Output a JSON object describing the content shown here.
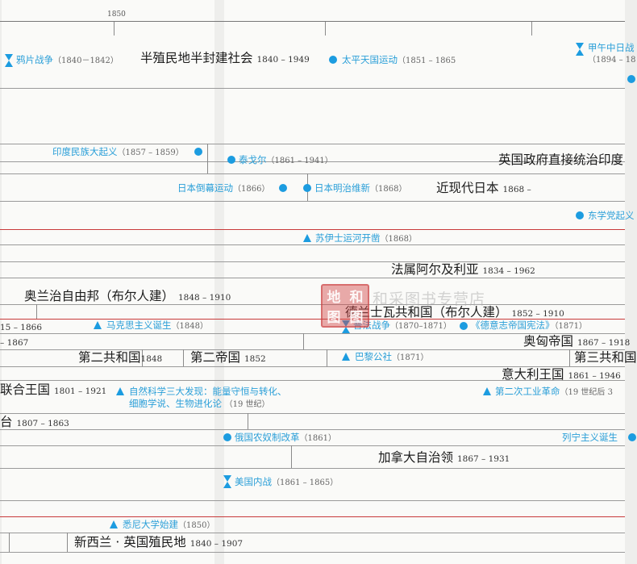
{
  "axis": {
    "tick_1850": "1850"
  },
  "events": {
    "opium_war": {
      "label": "鸦片战争",
      "years": "（1840－1842）"
    },
    "semi_colonial": {
      "label": "半殖民地半封建社会",
      "years": "1840 – 1949"
    },
    "taiping": {
      "label": "太平天国运动",
      "years": "（1851 – 1865"
    },
    "sino_japanese": {
      "label": "甲午中日战",
      "years": "（1894 – 18"
    },
    "indian_uprising": {
      "label": "印度民族大起义",
      "years": "（1857 – 1859）"
    },
    "tagore": {
      "label": "泰戈尔",
      "years": "（1861 – 1941）"
    },
    "british_india": {
      "label": "英国政府直接统治印度"
    },
    "tokugawa_fall": {
      "label": "日本倒幕运动",
      "years": "（1866）"
    },
    "meiji": {
      "label": "日本明治维新",
      "years": "（1868）"
    },
    "modern_japan": {
      "label": "近现代日本",
      "years": "1868 –"
    },
    "donghak": {
      "label": "东学党起义"
    },
    "suez": {
      "label": "苏伊士运河开凿",
      "years": "（1868）"
    },
    "french_algeria": {
      "label": "法属阿尔及利亚",
      "years": "1834 – 1962"
    },
    "orange_free_state": {
      "label": "奥兰治自由邦（布尔人建）",
      "years": "1848 – 1910"
    },
    "transvaal": {
      "label": "德兰士瓦共和国（布尔人建）",
      "years": "1852 – 1910"
    },
    "row_a_years": "15 – 1866",
    "marxism": {
      "label": "马克思主义诞生",
      "years": "（1848）"
    },
    "franco_prussian": {
      "label": "普法战争",
      "years": "（1870–1871）"
    },
    "german_constitution": {
      "label": "《德意志帝国宪法》",
      "years": "（1871）"
    },
    "row_b_years": "– 1867",
    "austria_hungary": {
      "label": "奥匈帝国",
      "years": "1867 – 1918"
    },
    "second_republic": {
      "label": "第二共和国",
      "years": "1848"
    },
    "second_empire": {
      "label": "第二帝国",
      "years": "1852"
    },
    "paris_commune": {
      "label": "巴黎公社",
      "years": "（1871）"
    },
    "third_republic": {
      "label": "第三共和国"
    },
    "italy": {
      "label": "意大利王国",
      "years": "1861 – 1946"
    },
    "united_kingdom": {
      "label": "联合王国",
      "years": "1801 – 1921"
    },
    "science_discoveries": {
      "line1": "自然科学三大发现：能量守恒与转化、",
      "line2": "细胞学说、生物进化论",
      "years": "（19 世纪）"
    },
    "second_industrial": {
      "label": "第二次工业革命",
      "years": "（19 世纪后 3"
    },
    "row_c_label": "台",
    "row_c_years": "1807 – 1863",
    "russian_serf": {
      "label": "俄国农奴制改革",
      "years": "（1861）"
    },
    "leninism": {
      "label": "列宁主义诞生"
    },
    "canada": {
      "label": "加拿大自治领",
      "years": "1867 – 1931"
    },
    "us_civil_war": {
      "label": "美国内战",
      "years": "（1861 – 1865）"
    },
    "sydney_uni": {
      "label": "悉尼大学始建",
      "years": "（1850）"
    },
    "new_zealand": {
      "label": "新西兰 · 英国殖民地",
      "years": "1840 – 1907"
    }
  },
  "stamp": {
    "chars": [
      "地",
      "和",
      "图",
      "图"
    ]
  },
  "watermark": "和采图书专营店",
  "colors": {
    "event_blue": "#1c9ce0",
    "label_blue": "#2a9fd8",
    "rule_red": "#c83a3a"
  }
}
